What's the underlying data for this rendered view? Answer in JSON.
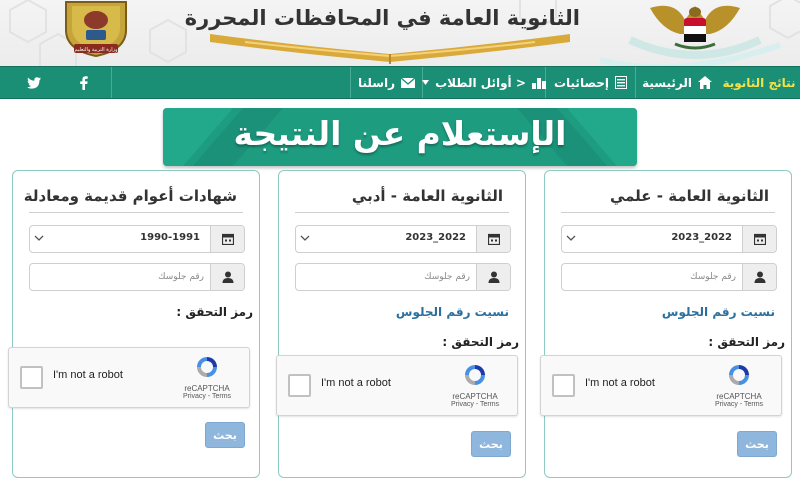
{
  "header": {
    "site_title": "الثانوية العامة في المحافظات المحررة",
    "ministry_label": "وزارة التربية والتعليم"
  },
  "nav": {
    "items": [
      {
        "label": "نتائج الثانوية",
        "icon": null,
        "active": true
      },
      {
        "label": "الرئيسية",
        "icon": "home-icon"
      },
      {
        "label": "إحصائيات",
        "icon": "list-icon"
      },
      {
        "label": "< أوائل الطلاب",
        "icon": "podium-icon",
        "dropdown": true
      },
      {
        "label": "راسلنا",
        "icon": "envelope-icon"
      }
    ],
    "social": [
      "facebook-icon",
      "twitter-icon"
    ]
  },
  "banner": {
    "text": "الإستعلام عن النتيجة"
  },
  "cards": [
    {
      "title": "الثانوية العامة - علمي",
      "year": "2023_2022",
      "seat_placeholder": "رقم جلوسك",
      "forgot_label": "نسيت رقم الجلوس",
      "verify_label": "رمز التحقق :",
      "search_label": "بحث"
    },
    {
      "title": "الثانوية العامة - أدبي",
      "year": "2023_2022",
      "seat_placeholder": "رقم جلوسك",
      "forgot_label": "نسيت رقم الجلوس",
      "verify_label": "رمز التحقق :",
      "search_label": "بحث"
    },
    {
      "title": "شهادات أعوام قديمة ومعادلة",
      "year": "1990-1991",
      "seat_placeholder": "رقم جلوسك",
      "verify_label": "رمز التحقق :",
      "search_label": "بحث"
    }
  ],
  "captcha": {
    "label": "I'm not a robot",
    "brand": "reCAPTCHA",
    "terms": "Privacy - Terms"
  },
  "colors": {
    "nav_green": "#1b8f75",
    "active_nav": "#f2e24a",
    "banner_green": "#1d9c80",
    "card_border": "#8fc9c4",
    "search_button": "#8fb7de",
    "link_blue": "#2a6f9e"
  }
}
